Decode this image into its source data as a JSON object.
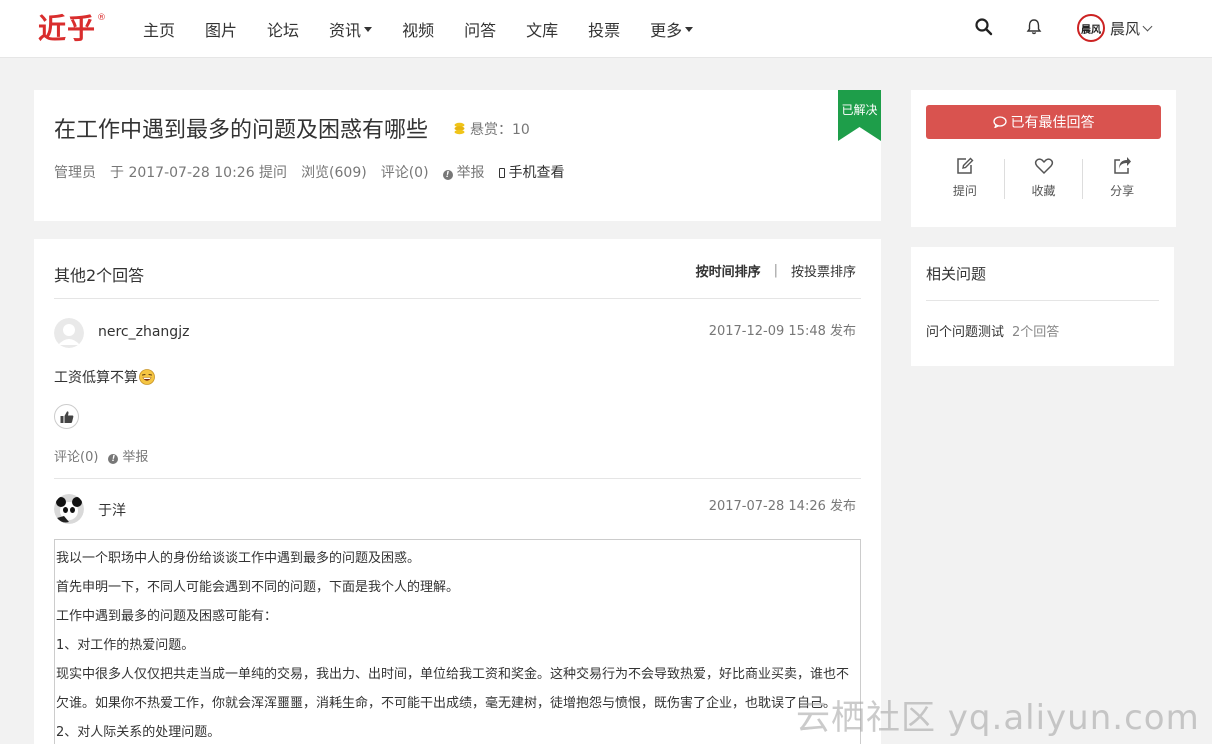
{
  "header": {
    "logo_text": "近乎",
    "logo_mark": "®",
    "nav": [
      {
        "label": "主页",
        "dropdown": false
      },
      {
        "label": "图片",
        "dropdown": false
      },
      {
        "label": "论坛",
        "dropdown": false
      },
      {
        "label": "资讯",
        "dropdown": true
      },
      {
        "label": "视频",
        "dropdown": false
      },
      {
        "label": "问答",
        "dropdown": false
      },
      {
        "label": "文库",
        "dropdown": false
      },
      {
        "label": "投票",
        "dropdown": false
      },
      {
        "label": "更多",
        "dropdown": true
      }
    ],
    "user": {
      "name": "晨风",
      "avatar_text": "晨风"
    }
  },
  "question": {
    "title": "在工作中遇到最多的问题及困惑有哪些",
    "bounty_label": "悬赏：10",
    "author": "管理员",
    "asked": "于 2017-07-28 10:26 提问",
    "views": "浏览(609)",
    "comments": "评论(0)",
    "report": "举报",
    "mobile": "手机查看",
    "status_ribbon": "已解决"
  },
  "answers": {
    "count_label": "其他2个回答",
    "sort_time": "按时间排序",
    "sort_sep": "|",
    "sort_votes": "按投票排序",
    "items": [
      {
        "user": "nerc_zhangjz",
        "time": "2017-12-09 15:48 发布",
        "content": "工资低算不算",
        "comments": "评论(0)",
        "report": "举报"
      },
      {
        "user": "于洋",
        "time": "2017-07-28 14:26 发布",
        "paragraphs": [
          "我以一个职场中人的身份给谈谈工作中遇到最多的问题及困惑。",
          "首先申明一下，不同人可能会遇到不同的问题，下面是我个人的理解。",
          "工作中遇到最多的问题及困惑可能有：",
          "1、对工作的热爱问题。",
          "现实中很多人仅仅把共走当成一单纯的交易，我出力、出时间，单位给我工资和奖金。这种交易行为不会导致热爱，好比商业买卖，谁也不",
          "欠谁。如果你不热爱工作，你就会浑浑噩噩，消耗生命，不可能干出成绩，毫无建树，徒增抱怨与愤恨，既伤害了企业，也耽误了自己。",
          "2、对人际关系的处理问题。"
        ]
      }
    ]
  },
  "sidebar": {
    "best_answer_label": "已有最佳回答",
    "actions": [
      "提问",
      "收藏",
      "分享"
    ],
    "related_title": "相关问题",
    "related": [
      {
        "title": "问个问题测试",
        "count": "2个回答"
      }
    ]
  },
  "watermark": "云栖社区 yq.aliyun.com",
  "colors": {
    "brand": "#d92d2d",
    "accent_button": "#d9534f",
    "solved_ribbon": "#1e9e4a",
    "coin": "#f0c419"
  }
}
